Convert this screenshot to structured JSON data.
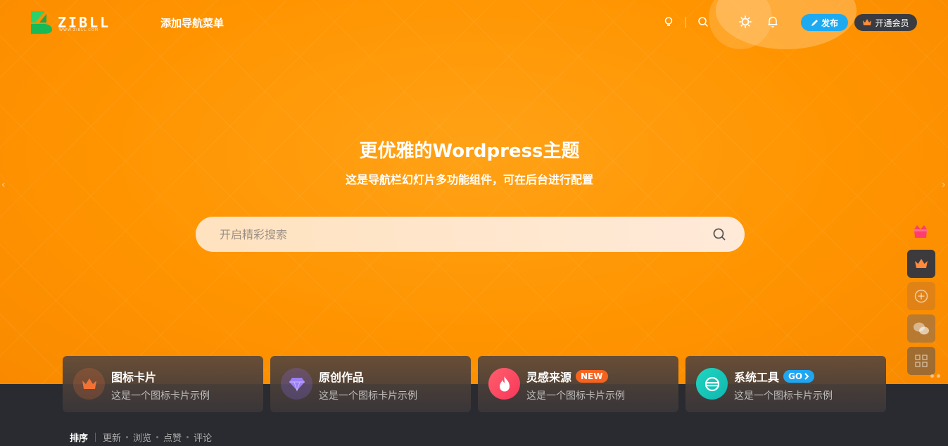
{
  "header": {
    "logo_text": "ZIBLL",
    "logo_sub": "WWW.ZIBLL.COM",
    "nav_menu": "添加导航菜单",
    "publish_label": "发布",
    "vip_label": "开通会员"
  },
  "hero": {
    "title": "更优雅的Wordpress主题",
    "subtitle": "这是导航栏幻灯片多功能组件，可在后台进行配置",
    "search_placeholder": "开启精彩搜索"
  },
  "cards": [
    {
      "title": "图标卡片",
      "desc": "这是一个图标卡片示例",
      "icon": "crown-icon",
      "color": "#f27235"
    },
    {
      "title": "原创作品",
      "desc": "这是一个图标卡片示例",
      "icon": "diamond-icon",
      "color": "#8a6cf0"
    },
    {
      "title": "灵感来源",
      "desc": "这是一个图标卡片示例",
      "icon": "fire-icon",
      "badge": "NEW",
      "badge_color": "#f5631f",
      "color": "#f7375a"
    },
    {
      "title": "系统工具",
      "desc": "这是一个图标卡片示例",
      "icon": "tool-icon",
      "badge": "GO",
      "badge_color": "#1ea6f3",
      "color": "#11c1b5"
    }
  ],
  "sort": {
    "items": [
      "排序",
      "更新",
      "浏览",
      "点赞",
      "评论"
    ]
  },
  "colors": {
    "hero": "#ff9400",
    "publish": "#1eaaf1",
    "dark": "#2a2b30"
  }
}
